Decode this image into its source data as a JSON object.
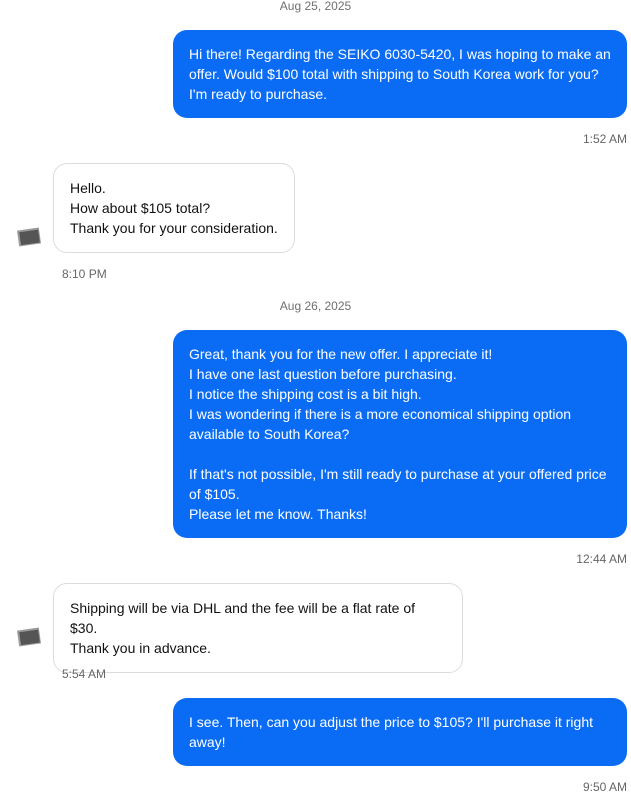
{
  "accent_color": "#0a6cf5",
  "messages": [
    {
      "kind": "date",
      "text": "Aug 25, 2025"
    },
    {
      "kind": "out",
      "lines": [
        "Hi there! Regarding the SEIKO 6030-5420, I was hoping to make an",
        "offer. Would $100 total with shipping to South Korea work for you?",
        "I'm ready to purchase."
      ],
      "time": "1:52 AM"
    },
    {
      "kind": "in",
      "lines": [
        "Hello.",
        "How about $105 total?",
        "Thank you for your consideration."
      ],
      "time": "8:10 PM"
    },
    {
      "kind": "date",
      "text": "Aug 26, 2025"
    },
    {
      "kind": "out",
      "lines": [
        "Great, thank you for the new offer. I appreciate it!",
        "I have one last question before purchasing.",
        "I notice the shipping cost is a bit high.",
        "I was wondering if there is a more economical shipping option",
        "available to South Korea?",
        "",
        "If that's not possible, I'm still ready to purchase at your offered price",
        "of $105.",
        "Please let me know. Thanks!"
      ],
      "time": "12:44 AM"
    },
    {
      "kind": "in",
      "lines": [
        "Shipping will be via DHL and the fee will be a flat rate of $30.",
        "Thank you in advance."
      ],
      "time": "5:54 AM"
    },
    {
      "kind": "out",
      "lines": [
        "I see. Then, can you adjust the price to $105? I'll purchase it right",
        "away!"
      ],
      "time": "9:50 AM"
    }
  ]
}
